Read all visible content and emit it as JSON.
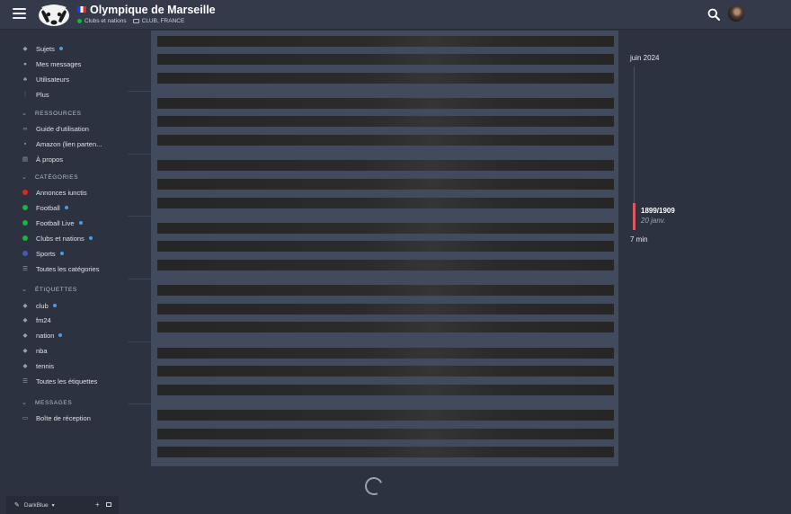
{
  "header": {
    "title": "Olympique de Marseille",
    "category": "Clubs et nations",
    "tags": "CLUB, FRANCE"
  },
  "sidebar": {
    "main_items": [
      {
        "label": "Sujets",
        "icon": "layers-icon",
        "new": true
      },
      {
        "label": "Mes messages",
        "icon": "chat-icon",
        "new": false
      },
      {
        "label": "Utilisateurs",
        "icon": "users-icon",
        "new": false
      },
      {
        "label": "Plus",
        "icon": "more-icon",
        "new": false
      }
    ],
    "resources": {
      "heading": "RESSOURCES",
      "items": [
        {
          "label": "Guide d'utilisation",
          "icon": "link-icon"
        },
        {
          "label": "Amazon (lien parten...",
          "icon": "gift-icon"
        },
        {
          "label": "À propos",
          "icon": "info-icon"
        }
      ]
    },
    "categories": {
      "heading": "CATÉGORIES",
      "items": [
        {
          "label": "Annonces iunctis",
          "color": "#e02525",
          "new": false
        },
        {
          "label": "Football",
          "color": "#18b53a",
          "new": true
        },
        {
          "label": "Football Live",
          "color": "#18b53a",
          "new": true
        },
        {
          "label": "Clubs et nations",
          "color": "#18b53a",
          "new": true
        },
        {
          "label": "Sports",
          "color": "#4858b8",
          "new": true
        },
        {
          "label": "Toutes les catégories",
          "icon": "list-icon",
          "new": false
        }
      ]
    },
    "labels": {
      "heading": "ÉTIQUETTES",
      "items": [
        {
          "label": "club",
          "new": true
        },
        {
          "label": "fm24",
          "new": false
        },
        {
          "label": "nation",
          "new": true
        },
        {
          "label": "nba",
          "new": false
        },
        {
          "label": "tennis",
          "new": false
        },
        {
          "label": "Toutes les étiquettes",
          "new": false
        }
      ]
    },
    "messages": {
      "heading": "MESSAGES",
      "items": [
        {
          "label": "Boîte de réception",
          "icon": "inbox-icon"
        }
      ]
    }
  },
  "timeline": {
    "start": "juin 2024",
    "position": "1899/1909",
    "date": "20 janv.",
    "end": "7 min",
    "progress_fraction": 0.994
  },
  "footer": {
    "theme": "DarkBlue"
  },
  "colors": {
    "background": "#2d3241",
    "header": "#343a4a",
    "accent_new": "#4d9be0",
    "timeline_handle": "#e0575f"
  }
}
